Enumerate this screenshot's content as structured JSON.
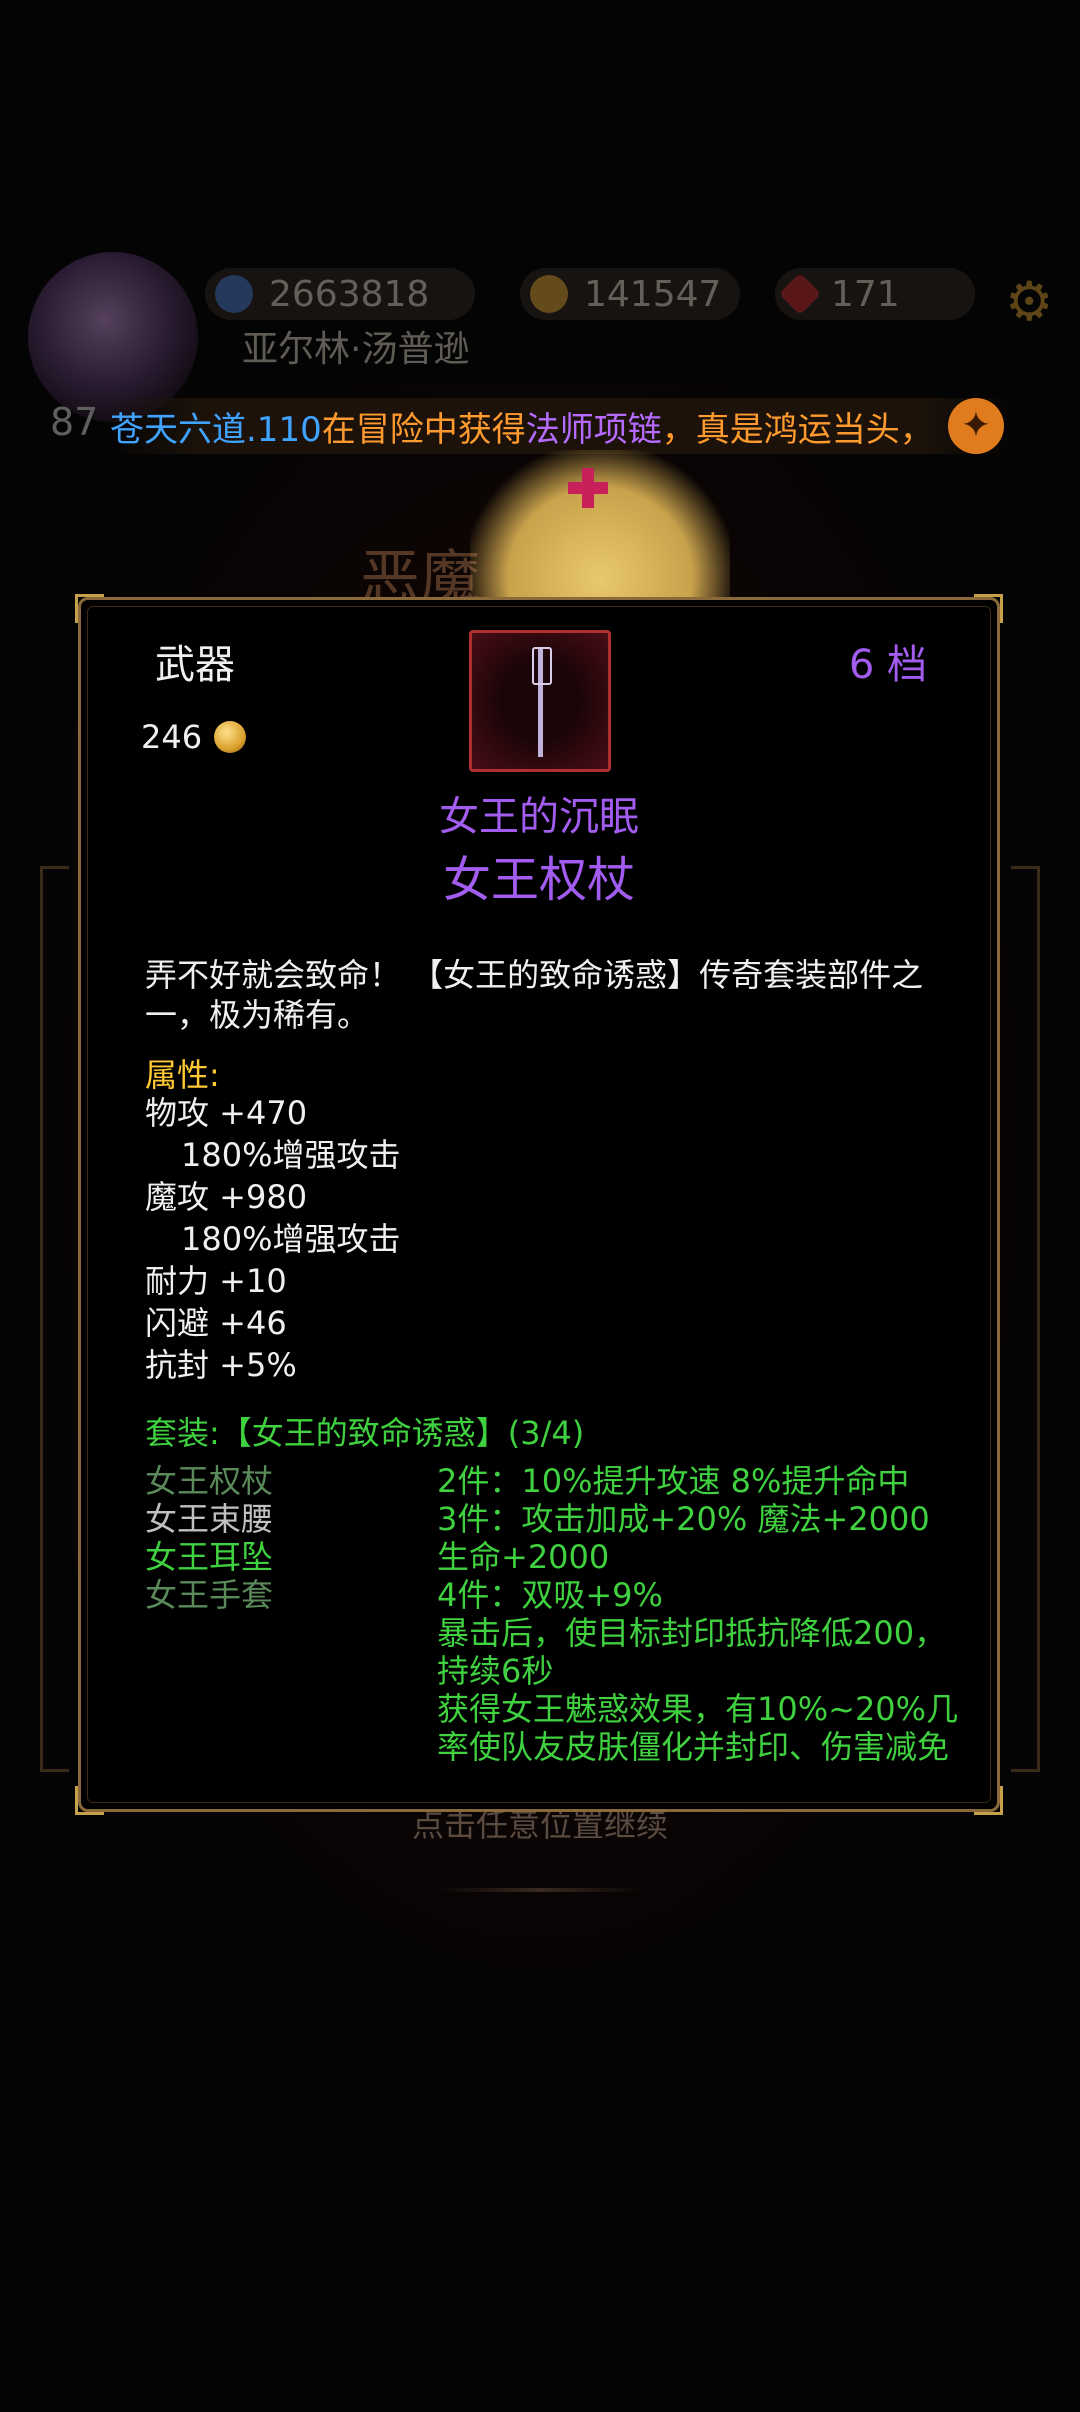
{
  "header": {
    "level": "87",
    "player_name": "亚尔林·汤普逊",
    "resources": [
      {
        "icon": "diamond-icon",
        "value": "2663818"
      },
      {
        "icon": "gold-coin-icon",
        "value": "141547"
      },
      {
        "icon": "ruby-icon",
        "value": "171"
      }
    ]
  },
  "announcement": {
    "player": "苍天六道.110",
    "text1": "在冒险中获得",
    "item": "法师项链",
    "text2": "，真是鸿运当头，"
  },
  "background_title": "恶魔",
  "item": {
    "category": "武器",
    "tier": "6  档",
    "price": "246",
    "subtitle": "女王的沉眠",
    "name": "女王权杖",
    "description": "弄不好就会致命！ 【女王的致命诱惑】传奇套装部件之一，极为稀有。",
    "attr_header": "属性:",
    "attributes": [
      {
        "text": "物攻 +470",
        "indent": false
      },
      {
        "text": "180%增强攻击",
        "indent": true
      },
      {
        "text": "魔攻 +980",
        "indent": false
      },
      {
        "text": "180%增强攻击",
        "indent": true
      },
      {
        "text": "耐力 +10",
        "indent": false
      },
      {
        "text": "闪避 +46",
        "indent": false
      },
      {
        "text": "抗封 +5%",
        "indent": false
      }
    ],
    "set_header": "套装:【女王的致命诱惑】(3/4)",
    "set_pieces": [
      {
        "name": "女王权杖",
        "style": "dim"
      },
      {
        "name": "女王束腰",
        "style": "gray"
      },
      {
        "name": "女王耳坠",
        "style": "bright"
      },
      {
        "name": "女王手套",
        "style": "dim"
      }
    ],
    "set_effects": [
      "2件：10%提升攻速 8%提升命中",
      "3件：攻击加成+20% 魔法+2000",
      "生命+2000",
      "4件：双吸+9%",
      "暴击后，使目标封印抵抗降低200，持续6秒",
      "获得女王魅惑效果，有10%~20%几率使队友皮肤僵化并封印、伤害减免"
    ]
  },
  "continue_hint": "点击任意位置继续",
  "colors": {
    "purple": "#a35cf0",
    "gold": "#ffc933",
    "green": "#3fd13f",
    "border": "#8a6a3a"
  }
}
